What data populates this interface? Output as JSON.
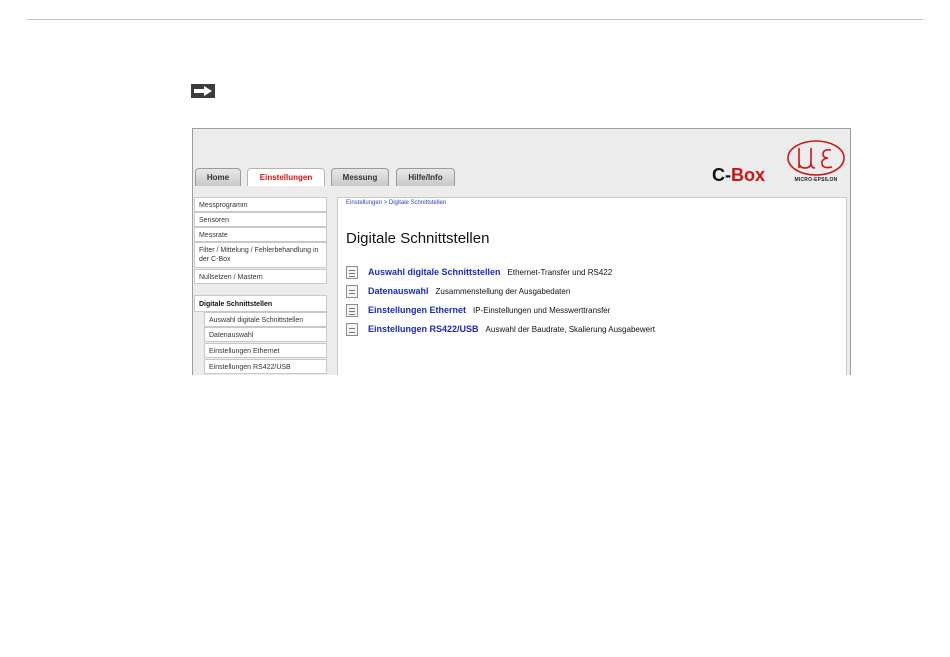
{
  "tabs": [
    {
      "label": "Home",
      "active": false
    },
    {
      "label": "Einstellungen",
      "active": true
    },
    {
      "label": "Messung",
      "active": false
    },
    {
      "label": "Hilfe/Info",
      "active": false
    }
  ],
  "brand": {
    "prefix": "C-",
    "suffix": "Box",
    "logo_text": "MICRO-EPSILON",
    "accent": "#cc1515"
  },
  "sidebar": {
    "items": [
      "Messprogramm",
      "Sensoren",
      "Messrate",
      "Filter / Mittelung / Fehlerbehandlung in der C-Box",
      "Nullsetzen / Mastern"
    ],
    "section": "Digitale Schnittstellen",
    "subitems": [
      "Auswahl digitale Schnittstellen",
      "Datenauswahl",
      "Einstellungen Ethernet",
      "Einstellungen RS422/USB"
    ]
  },
  "content": {
    "breadcrumb": "Einstellungen > Digitale Schnittstellen",
    "title": "Digitale Schnittstellen",
    "rows": [
      {
        "link": "Auswahl digitale Schnittstellen",
        "desc": "Ethernet-Transfer und RS422",
        "icon": "interface-icon"
      },
      {
        "link": "Datenauswahl",
        "desc": "Zusammenstellung der Ausgabedaten",
        "icon": "document-icon"
      },
      {
        "link": "Einstellungen Ethernet",
        "desc": "IP-Einstellungen und Messwerttransfer",
        "icon": "ethernet-icon"
      },
      {
        "link": "Einstellungen RS422/USB",
        "desc": "Auswahl der Baudrate, Skalierung Ausgabewert",
        "icon": "usb-icon"
      }
    ]
  }
}
